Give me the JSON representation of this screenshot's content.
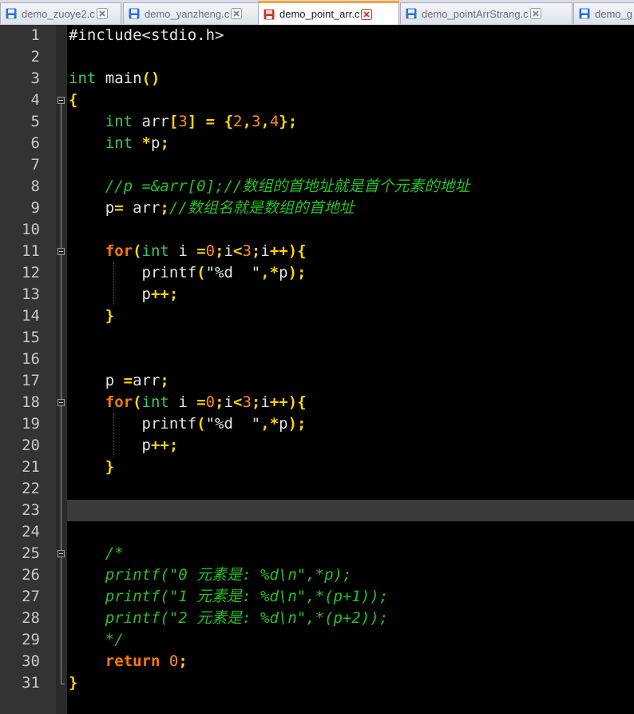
{
  "tabs": [
    {
      "label": "demo_zuoye2.c",
      "active": false,
      "icon": "save-icon"
    },
    {
      "label": "demo_yanzheng.c",
      "active": false,
      "icon": "save-icon"
    },
    {
      "label": "demo_point_arr.c",
      "active": true,
      "icon": "save-icon-red"
    },
    {
      "label": "demo_pointArrStrang.c",
      "active": false,
      "icon": "save-icon"
    },
    {
      "label": "demo_g",
      "active": false,
      "icon": "save-icon"
    }
  ],
  "editor": {
    "current_line": 23,
    "lines": [
      {
        "n": "1",
        "tokens": [
          [
            "pp",
            "#include<stdio.h>"
          ]
        ]
      },
      {
        "n": "2",
        "tokens": []
      },
      {
        "n": "3",
        "tokens": [
          [
            "ty",
            "int"
          ],
          [
            "tx",
            " main"
          ],
          [
            "op",
            "()"
          ]
        ]
      },
      {
        "n": "4",
        "tokens": [
          [
            "op",
            "{"
          ]
        ]
      },
      {
        "n": "5",
        "tokens": [
          [
            "tx",
            "    "
          ],
          [
            "ty",
            "int"
          ],
          [
            "tx",
            " arr"
          ],
          [
            "op",
            "["
          ],
          [
            "num",
            "3"
          ],
          [
            "op",
            "]"
          ],
          [
            "tx",
            " "
          ],
          [
            "op",
            "="
          ],
          [
            "tx",
            " "
          ],
          [
            "op",
            "{"
          ],
          [
            "num",
            "2"
          ],
          [
            "op",
            ","
          ],
          [
            "num",
            "3"
          ],
          [
            "op",
            ","
          ],
          [
            "num",
            "4"
          ],
          [
            "op",
            "};"
          ]
        ]
      },
      {
        "n": "6",
        "tokens": [
          [
            "tx",
            "    "
          ],
          [
            "ty",
            "int"
          ],
          [
            "tx",
            " "
          ],
          [
            "op",
            "*"
          ],
          [
            "tx",
            "p"
          ],
          [
            "op",
            ";"
          ]
        ]
      },
      {
        "n": "7",
        "tokens": []
      },
      {
        "n": "8",
        "tokens": [
          [
            "tx",
            "    "
          ],
          [
            "cm",
            "//p =&arr[0];//数组的首地址就是首个元素的地址"
          ]
        ]
      },
      {
        "n": "9",
        "tokens": [
          [
            "tx",
            "    p"
          ],
          [
            "op",
            "="
          ],
          [
            "tx",
            " arr"
          ],
          [
            "op",
            ";"
          ],
          [
            "cm",
            "//数组名就是数组的首地址"
          ]
        ]
      },
      {
        "n": "10",
        "tokens": []
      },
      {
        "n": "11",
        "tokens": [
          [
            "tx",
            "    "
          ],
          [
            "kw",
            "for"
          ],
          [
            "op",
            "("
          ],
          [
            "ty",
            "int"
          ],
          [
            "tx",
            " i "
          ],
          [
            "op",
            "="
          ],
          [
            "num",
            "0"
          ],
          [
            "op",
            ";"
          ],
          [
            "tx",
            "i"
          ],
          [
            "op",
            "<"
          ],
          [
            "num",
            "3"
          ],
          [
            "op",
            ";"
          ],
          [
            "tx",
            "i"
          ],
          [
            "op",
            "++){"
          ]
        ]
      },
      {
        "n": "12",
        "tokens": [
          [
            "tx",
            "        printf"
          ],
          [
            "op",
            "("
          ],
          [
            "str",
            "\"%d  \""
          ],
          [
            "op",
            ",*"
          ],
          [
            "tx",
            "p"
          ],
          [
            "op",
            ");"
          ]
        ]
      },
      {
        "n": "13",
        "tokens": [
          [
            "tx",
            "        p"
          ],
          [
            "op",
            "++;"
          ]
        ]
      },
      {
        "n": "14",
        "tokens": [
          [
            "tx",
            "    "
          ],
          [
            "op",
            "}"
          ]
        ]
      },
      {
        "n": "15",
        "tokens": []
      },
      {
        "n": "16",
        "tokens": []
      },
      {
        "n": "17",
        "tokens": [
          [
            "tx",
            "    p "
          ],
          [
            "op",
            "="
          ],
          [
            "tx",
            "arr"
          ],
          [
            "op",
            ";"
          ]
        ]
      },
      {
        "n": "18",
        "tokens": [
          [
            "tx",
            "    "
          ],
          [
            "kw",
            "for"
          ],
          [
            "op",
            "("
          ],
          [
            "ty",
            "int"
          ],
          [
            "tx",
            " i "
          ],
          [
            "op",
            "="
          ],
          [
            "num",
            "0"
          ],
          [
            "op",
            ";"
          ],
          [
            "tx",
            "i"
          ],
          [
            "op",
            "<"
          ],
          [
            "num",
            "3"
          ],
          [
            "op",
            ";"
          ],
          [
            "tx",
            "i"
          ],
          [
            "op",
            "++){"
          ]
        ]
      },
      {
        "n": "19",
        "tokens": [
          [
            "tx",
            "        printf"
          ],
          [
            "op",
            "("
          ],
          [
            "str",
            "\"%d  \""
          ],
          [
            "op",
            ",*"
          ],
          [
            "tx",
            "p"
          ],
          [
            "op",
            ");"
          ]
        ]
      },
      {
        "n": "20",
        "tokens": [
          [
            "tx",
            "        p"
          ],
          [
            "op",
            "++;"
          ]
        ]
      },
      {
        "n": "21",
        "tokens": [
          [
            "tx",
            "    "
          ],
          [
            "op",
            "}"
          ]
        ]
      },
      {
        "n": "22",
        "tokens": []
      },
      {
        "n": "23",
        "tokens": []
      },
      {
        "n": "24",
        "tokens": []
      },
      {
        "n": "25",
        "tokens": [
          [
            "tx",
            "    "
          ],
          [
            "cm",
            "/*"
          ]
        ]
      },
      {
        "n": "26",
        "tokens": [
          [
            "tx",
            "    "
          ],
          [
            "cm",
            "printf(\"0 元素是: %d\\n\",*p);"
          ]
        ]
      },
      {
        "n": "27",
        "tokens": [
          [
            "tx",
            "    "
          ],
          [
            "cm",
            "printf(\"1 元素是: %d\\n\",*(p+1));"
          ]
        ]
      },
      {
        "n": "28",
        "tokens": [
          [
            "tx",
            "    "
          ],
          [
            "cm",
            "printf(\"2 元素是: %d\\n\",*(p+2));"
          ]
        ]
      },
      {
        "n": "29",
        "tokens": [
          [
            "tx",
            "    "
          ],
          [
            "cm",
            "*/"
          ]
        ]
      },
      {
        "n": "30",
        "tokens": [
          [
            "tx",
            "    "
          ],
          [
            "kw",
            "return"
          ],
          [
            "tx",
            " "
          ],
          [
            "num",
            "0"
          ],
          [
            "op",
            ";"
          ]
        ]
      },
      {
        "n": "31",
        "tokens": [
          [
            "op",
            "}"
          ]
        ]
      }
    ]
  }
}
